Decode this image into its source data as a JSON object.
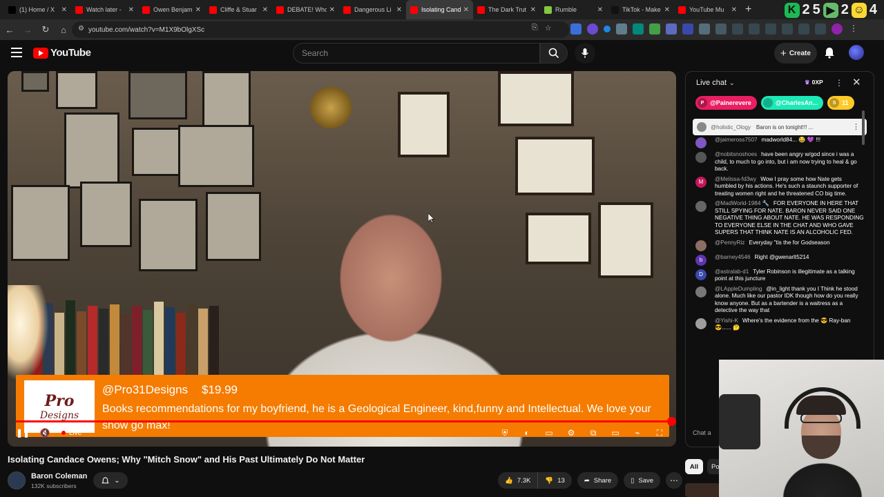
{
  "browser": {
    "tabs": [
      {
        "label": "(1) Home / X",
        "icon": "x-icon",
        "color": "#000000"
      },
      {
        "label": "Watch later -",
        "icon": "youtube-icon",
        "color": "#ff0000"
      },
      {
        "label": "Owen Benjam",
        "icon": "youtube-icon",
        "color": "#ff0000"
      },
      {
        "label": "Cliffe & Stuar",
        "icon": "youtube-icon",
        "color": "#ff0000"
      },
      {
        "label": "DEBATE! Who",
        "icon": "youtube-icon",
        "color": "#ff0000"
      },
      {
        "label": "Dangerous Li",
        "icon": "youtube-icon",
        "color": "#ff0000"
      },
      {
        "label": "Isolating Cand",
        "icon": "youtube-icon",
        "color": "#ff0000",
        "active": true
      },
      {
        "label": "The Dark Trut",
        "icon": "youtube-icon",
        "color": "#ff0000"
      },
      {
        "label": "Rumble",
        "icon": "rumble-icon",
        "color": "#85c742"
      },
      {
        "label": "TikTok - Make",
        "icon": "tiktok-icon",
        "color": "#111111"
      },
      {
        "label": "YouTube Mu",
        "icon": "youtube-music-icon",
        "color": "#ff0000"
      }
    ],
    "new_tab": "+",
    "overlay_digits": [
      "2",
      "5",
      "2",
      "4"
    ],
    "url": "youtube.com/watch?v=M1X9bOlgXSc"
  },
  "youtube": {
    "logo_text": "YouTube",
    "search_placeholder": "Search",
    "create_label": "Create"
  },
  "video": {
    "superchat": {
      "avatar_line1": "Pro",
      "avatar_line2": "Designs",
      "author": "@Pro31Designs",
      "amount": "$19.99",
      "message": "Books recommendations for my boyfriend, he is a Geological Engineer, kind,funny and Intellectual. We love your show go max!"
    },
    "live_label": "Live",
    "progress": 1.0,
    "title": "Isolating Candace Owens; Why \"Mitch Snow\" and His Past Ultimately Do Not Matter",
    "channel": "Baron Coleman",
    "subscribers": "132K subscribers",
    "likes": "7.3K",
    "dislikes": "13",
    "share_label": "Share",
    "save_label": "Save"
  },
  "chat": {
    "title": "Live chat",
    "xp": "0XP",
    "ticker": [
      {
        "name": "@Painerevere",
        "color": "#e91e63",
        "initial": "P"
      },
      {
        "name": "@CharlesAn...",
        "color": "#1de9b6",
        "initial": ""
      },
      {
        "name": "11",
        "color": "#ffca28",
        "initial": "S"
      }
    ],
    "pinned": {
      "author": "@holistic_Ology",
      "text": "Baron is on tonight!!! ..."
    },
    "messages": [
      {
        "author": "@jaimeross7507",
        "text": "madworld84... 😂 💜 !!!",
        "avatar_color": "#7e57c2",
        "initial": ""
      },
      {
        "author": "@nobitsnoshoes",
        "text": "have been angry w/god since i was a child, to much to go into, but i am now trying to heal & go back.",
        "avatar_color": "#555555",
        "initial": ""
      },
      {
        "author": "@Melissa-fd3wy",
        "text": "Wow I pray some how Nate gets humbled by his actions. He's such a staunch supporter of treating women right and he threatened CO big time.",
        "avatar_color": "#c2185b",
        "initial": "M"
      },
      {
        "author": "@MadWorld-1984 🔧",
        "text": "FOR EVERYONE IN HERE THAT STILL SPYING FOR NATE. BARON NEVER SAID ONE NEGATIVE THING ABOUT NATE. HE WAS RESPONDING TO EVERYONE ELSE IN THE CHAT AND WHO GAVE SUPERS THAT THINK NATE IS AN ALCOHOLIC FED.",
        "avatar_color": "#666666",
        "initial": ""
      },
      {
        "author": "@PennyRiz",
        "text": "Everyday \"tis the for Godseason",
        "avatar_color": "#8d6e63",
        "initial": ""
      },
      {
        "author": "@barney4546",
        "text": "Right @gwenarlt5214",
        "avatar_color": "#5e35b1",
        "initial": "b"
      },
      {
        "author": "@astralab-d1",
        "text": "Tyler Robinson is illegitimate as a talking point at this juncture",
        "avatar_color": "#3949ab",
        "initial": "D"
      },
      {
        "author": "@LAppleDumpling",
        "text": "@in_light thank you I Think he stood alone. Much like our pastor IDK though how do you really know anyone. But as a bartender is a waitress as a detective the way that",
        "avatar_color": "#777777",
        "initial": ""
      },
      {
        "author": "@Yishi-K",
        "text": "Where's the evidence from the 😎 Ray-ban 😎...... 🤔",
        "avatar_color": "#9e9e9e",
        "initial": ""
      }
    ],
    "input_placeholder": "Chat a"
  },
  "sidebar": {
    "chips": [
      "All",
      "Po"
    ]
  }
}
